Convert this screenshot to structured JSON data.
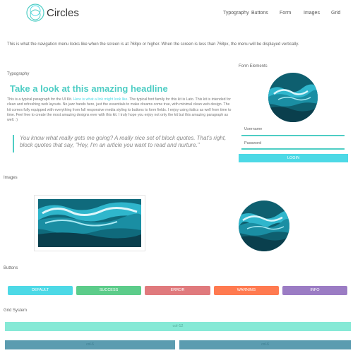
{
  "header": {
    "logo_text": "Circles",
    "nav": [
      "Typography",
      "Buttons",
      "Form",
      "Images",
      "Grid"
    ]
  },
  "intro": "This is what the navigation menu looks like when the screen is at 768px or higher. When the screen is less than 768px, the menu will be displayed vertically.",
  "typography": {
    "label": "Typography",
    "headline": "Take a look at this amazing headline",
    "para_before": "This is a typical paragraph for the UI Kit. ",
    "link": "Here is what a link might look like.",
    "para_after": " The typical font family for this kit is Lato. This kit is intended for clean and refreshing web layouts. No jazz hands here, just the essentials to make dreams come true, with minimal clean web design. The kit comes fully equipped with everything from full responsive media styling to buttons to form fields. I enjoy using italics as well from time to time. Feel free to create the most amazing designs ever with this kit. I truly hope you enjoy not only the kit but this amazing paragraph as well. :)",
    "quote": "You know what really gets me going? A really nice set of block quotes. That's right, block quotes that say, \"Hey, I'm an article you want to read and nurture.\""
  },
  "form": {
    "label": "Form Elements",
    "username_placeholder": "Username",
    "password_placeholder": "Password",
    "login_label": "LOGIN"
  },
  "images": {
    "label": "Images"
  },
  "buttons": {
    "label": "Buttons",
    "items": [
      {
        "label": "DEFAULT",
        "color": "#4dd9e6"
      },
      {
        "label": "SUCCESS",
        "color": "#5ccc8a"
      },
      {
        "label": "ERROR",
        "color": "#e07a7d"
      },
      {
        "label": "WARNING",
        "color": "#ff7a50"
      },
      {
        "label": "INFO",
        "color": "#9b7cc4"
      }
    ]
  },
  "grid": {
    "label": "Grid System",
    "col12": "col-12",
    "col6": [
      "col-6",
      "col-6"
    ]
  },
  "colors": {
    "accent": "#4ecdc4",
    "link": "#4dd9e6"
  }
}
